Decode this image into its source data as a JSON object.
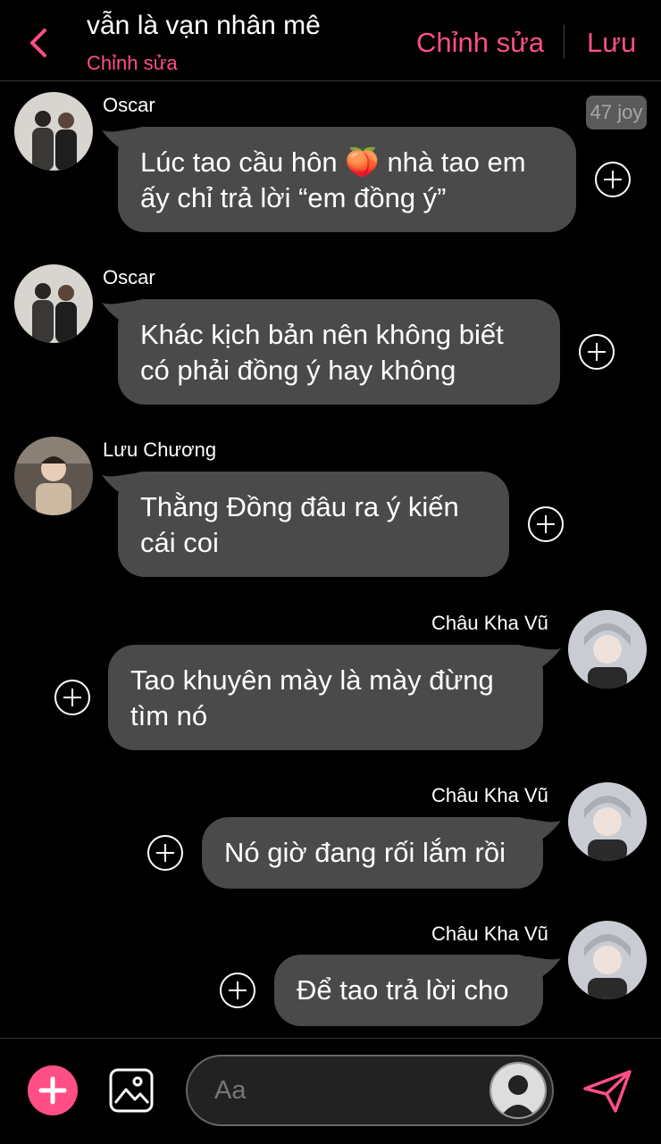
{
  "header": {
    "title": "vẫn là vạn nhân mê",
    "subtitle": "Chỉnh sửa",
    "edit_label": "Chỉnh sửa",
    "save_label": "Lưu"
  },
  "badge": "47 joy",
  "messages": [
    {
      "sender": "Oscar",
      "side": "left",
      "text": "Lúc tao cầu hôn 🍑 nhà tao em ấy chỉ trả lời “em đồng ý”"
    },
    {
      "sender": "Oscar",
      "side": "left",
      "text": "Khác kịch bản nên không biết có phải đồng ý hay không"
    },
    {
      "sender": "Lưu Chương",
      "side": "left",
      "text": "Thằng Đồng đâu ra ý kiến cái coi"
    },
    {
      "sender": "Châu Kha Vũ",
      "side": "right",
      "text": "Tao khuyên mày là mày đừng tìm nó"
    },
    {
      "sender": "Châu Kha Vũ",
      "side": "right",
      "text": "Nó giờ đang rối lắm rồi"
    },
    {
      "sender": "Châu Kha Vũ",
      "side": "right",
      "text": "Để tao trả lời cho"
    }
  ],
  "composer": {
    "placeholder": "Aa"
  },
  "colors": {
    "accent": "#ff4f86",
    "bubble": "#4a4a4a",
    "background": "#000000"
  }
}
